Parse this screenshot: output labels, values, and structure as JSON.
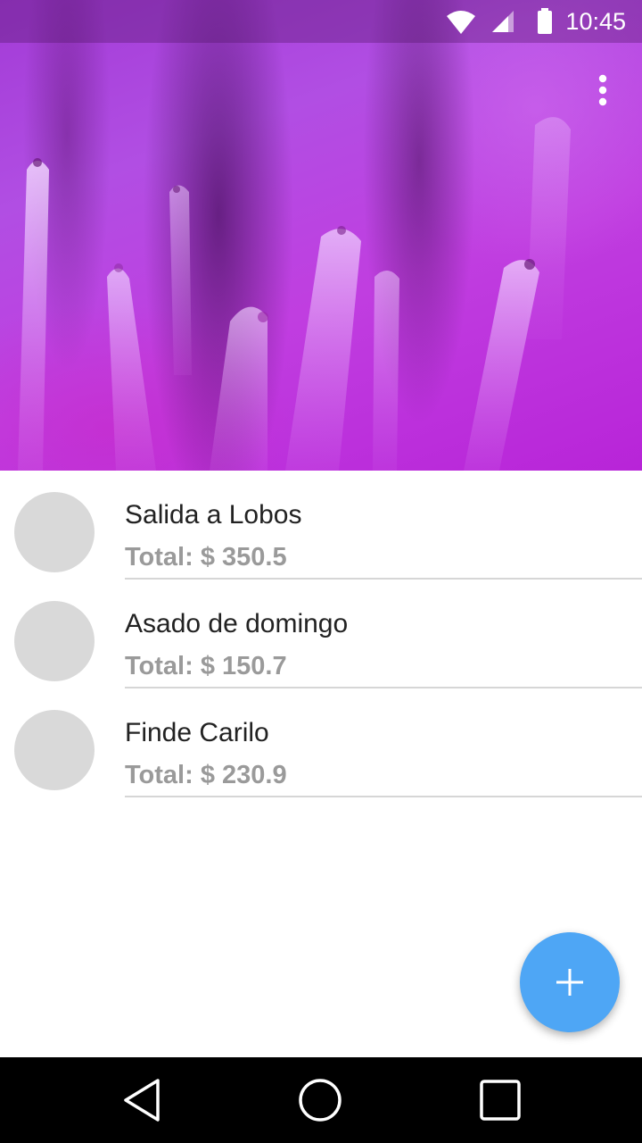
{
  "status_bar": {
    "time": "10:45",
    "icons": [
      "wifi-icon",
      "signal-icon",
      "battery-icon"
    ]
  },
  "toolbar": {
    "overflow_icon": "more-vert-icon"
  },
  "list": {
    "items": [
      {
        "title": "Salida a Lobos",
        "total": "Total: $ 350.5"
      },
      {
        "title": "Asado de domingo",
        "total": "Total: $ 150.7"
      },
      {
        "title": "Finde Carilo",
        "total": "Total: $ 230.9"
      }
    ]
  },
  "fab": {
    "icon": "plus-icon",
    "color": "#4ea6f5"
  },
  "nav_bar": {
    "icons": [
      "back-icon",
      "home-icon",
      "recents-icon"
    ]
  },
  "colors": {
    "header_purple": "#b14ee3",
    "avatar_gray": "#d9d9d9",
    "secondary_text": "#9a9a9a"
  }
}
